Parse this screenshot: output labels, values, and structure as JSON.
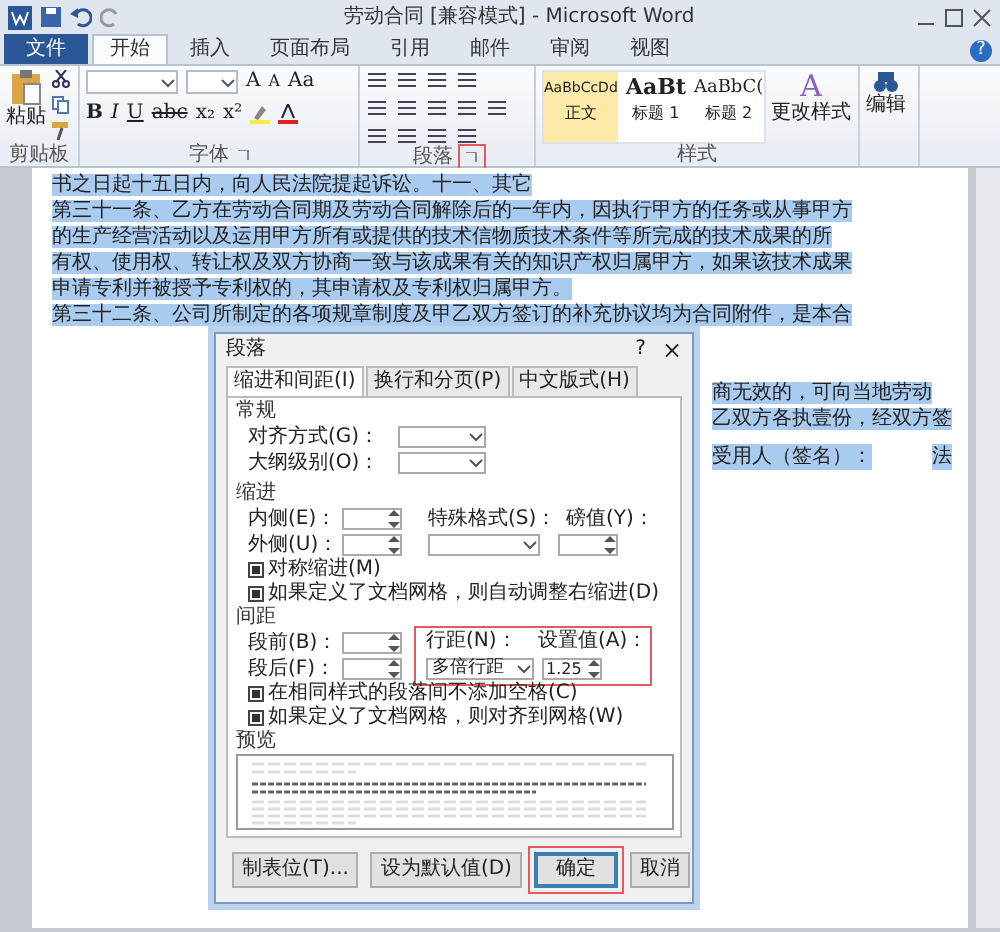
{
  "window": {
    "title": "劳动合同 [兼容模式] - Microsoft Word"
  },
  "ribbon_tabs": [
    {
      "label": "文件",
      "kind": "file",
      "selected": false
    },
    {
      "label": "开始",
      "kind": "tab",
      "selected": true
    },
    {
      "label": "插入",
      "kind": "tab",
      "selected": false
    },
    {
      "label": "页面布局",
      "kind": "tab",
      "selected": false
    },
    {
      "label": "引用",
      "kind": "tab",
      "selected": false
    },
    {
      "label": "邮件",
      "kind": "tab",
      "selected": false
    },
    {
      "label": "审阅",
      "kind": "tab",
      "selected": false
    },
    {
      "label": "视图",
      "kind": "tab",
      "selected": false
    }
  ],
  "ribbon": {
    "clipboard": {
      "paste_label": "粘贴",
      "group_label": "剪贴板"
    },
    "font": {
      "row1_buttons": [
        "A",
        "A",
        "Aa"
      ],
      "row2_buttons": [
        "B",
        "I",
        "U",
        "abc",
        "x₂",
        "x²"
      ],
      "group_label": "字体"
    },
    "paragraph": {
      "group_label": "段落",
      "launcher_highlighted": true
    },
    "styles": {
      "items": [
        {
          "sample": "AaBbCcDd",
          "name": "正文",
          "selected": true
        },
        {
          "sample": "AaBt",
          "name": "标题 1",
          "selected": false
        },
        {
          "sample": "AaBbC(",
          "name": "标题 2",
          "selected": false
        }
      ],
      "change_glyph": "A",
      "change_label": "更改样式",
      "group_label": "样式"
    },
    "help_glyph": "?",
    "editing": {
      "label": "编辑"
    }
  },
  "document": {
    "lines": [
      "书之日起十五日内，向人民法院提起诉讼。十一、其它",
      "第三十一条、乙方在劳动合同期及劳动合同解除后的一年内，因执行甲方的任务或从事甲方",
      "的生产经营活动以及运用甲方所有或提供的技术信物质技术条件等所完成的技术成果的所",
      "有权、使用权、转让权及双方协商一致与该成果有关的知识产权归属甲方，如果该技术成果",
      "申请专利并被授予专利权的，其申请权及专利权归属甲方。",
      "第三十二条、公司所制定的各项规章制度及甲乙双方签订的补充协议均为合同附件，是本合"
    ],
    "fragments": [
      "商无效的，可向当地劳动",
      "乙双方各执壹份，经双方签"
    ],
    "signature": {
      "label": "受用人（签名）：",
      "right": "法"
    }
  },
  "dialog": {
    "title": "段落",
    "help": "?",
    "close": "×",
    "tabs": [
      {
        "label": "缩进和间距(I)",
        "selected": true
      },
      {
        "label": "换行和分页(P)",
        "selected": false
      },
      {
        "label": "中文版式(H)",
        "selected": false
      }
    ],
    "general": {
      "heading": "常规",
      "alignment_label": "对齐方式(G)：",
      "outline_label": "大纲级别(O)："
    },
    "indent": {
      "heading": "缩进",
      "inside_label": "内侧(E)：",
      "outside_label": "外侧(U)：",
      "special_label": "特殊格式(S)：",
      "by_label": "磅值(Y)：",
      "checkboxes": [
        {
          "label": "对称缩进(M)",
          "checked": true
        },
        {
          "label": "如果定义了文档网格，则自动调整右缩进(D)",
          "checked": true
        }
      ]
    },
    "spacing": {
      "heading": "间距",
      "before_label": "段前(B)：",
      "after_label": "段后(F)：",
      "line_label": "行距(N)：",
      "line_value": "多倍行距",
      "at_label": "设置值(A)：",
      "at_value": "1.25",
      "highlighted": true,
      "checkboxes": [
        {
          "label": "在相同样式的段落间不添加空格(C)",
          "checked": true
        },
        {
          "label": "如果定义了文档网格，则对齐到网格(W)",
          "checked": true
        }
      ]
    },
    "preview": {
      "heading": "预览"
    },
    "buttons": [
      {
        "label": "制表位(T)...",
        "kind": "normal",
        "highlighted": false
      },
      {
        "label": "设为默认值(D)",
        "kind": "normal",
        "highlighted": false
      },
      {
        "label": "确定",
        "kind": "default",
        "highlighted": true
      },
      {
        "label": "取消",
        "kind": "normal",
        "highlighted": false
      }
    ]
  }
}
